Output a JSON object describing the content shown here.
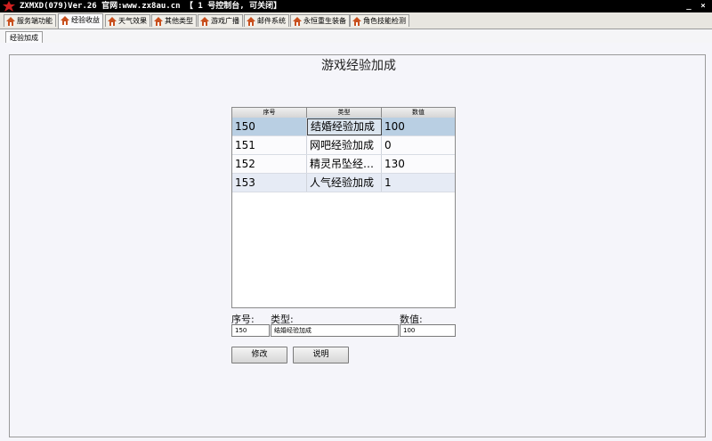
{
  "window": {
    "title": "ZXMXD(079)Ver.26 官网:www.zx8au.cn 【 1 号控制台, 可关闭】",
    "min_label": "_",
    "close_label": "×"
  },
  "tabs": [
    {
      "label": "服务端功能"
    },
    {
      "label": "经验收益"
    },
    {
      "label": "天气效果"
    },
    {
      "label": "其他类型"
    },
    {
      "label": "游戏广播"
    },
    {
      "label": "邮件系统"
    },
    {
      "label": "永恒重生装备"
    },
    {
      "label": "角色技能检测"
    }
  ],
  "subtab": {
    "label": "经验加成"
  },
  "panel": {
    "title": "游戏经验加成"
  },
  "table": {
    "headers": [
      "序号",
      "类型",
      "数值"
    ],
    "rows": [
      {
        "id": "150",
        "type": "结婚经验加成",
        "value": "100"
      },
      {
        "id": "151",
        "type": "网吧经验加成",
        "value": "0"
      },
      {
        "id": "152",
        "type": "精灵吊坠经验加成",
        "value": "130"
      },
      {
        "id": "153",
        "type": "人气经验加成",
        "value": "1"
      }
    ]
  },
  "form": {
    "id_label": "序号:",
    "type_label": "类型:",
    "value_label": "数值:",
    "id_value": "150",
    "type_value": "结婚经验加成",
    "value_value": "100"
  },
  "buttons": {
    "modify": "修改",
    "explain": "说明"
  },
  "colors": {
    "selected_row": "#b9cfe3",
    "tab_icon": "#c8501e"
  }
}
